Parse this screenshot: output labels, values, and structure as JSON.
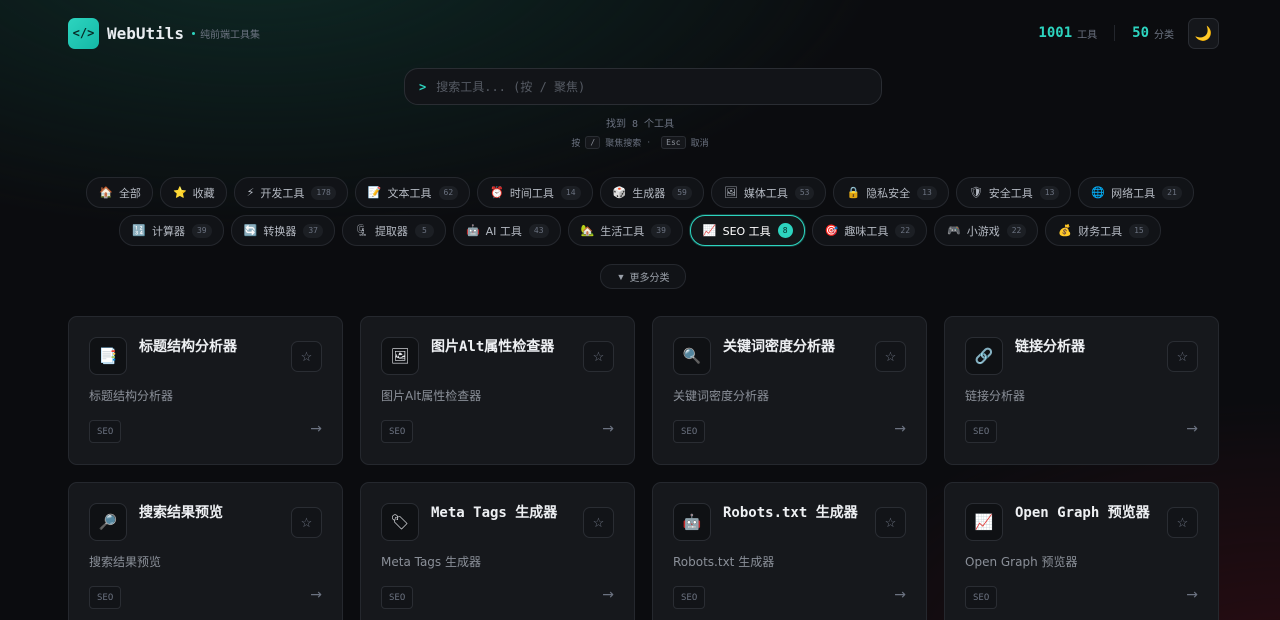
{
  "header": {
    "logo_glyph": "</>",
    "brand": "WebUtils",
    "subtitle": "纯前端工具集",
    "tools_count": "1001",
    "tools_label": "工具",
    "categories_count": "50",
    "categories_label": "分类",
    "theme_icon": "🌙"
  },
  "search": {
    "prompt": ">",
    "placeholder": "搜索工具... (按 / 聚焦)",
    "value": ""
  },
  "results": {
    "found_text": "找到 8 个工具",
    "hint_press": "按",
    "hint_slash_key": "/",
    "hint_focus": "聚焦搜索",
    "hint_dot": "·",
    "hint_esc_key": "Esc",
    "hint_cancel": "取消"
  },
  "categories_row1": [
    {
      "icon": "🏠",
      "label": "全部",
      "count": ""
    },
    {
      "icon": "⭐",
      "label": "收藏",
      "count": ""
    },
    {
      "icon": "⚡",
      "label": "开发工具",
      "count": "178"
    },
    {
      "icon": "📝",
      "label": "文本工具",
      "count": "62"
    },
    {
      "icon": "⏰",
      "label": "时间工具",
      "count": "14"
    },
    {
      "icon": "🎲",
      "label": "生成器",
      "count": "59"
    },
    {
      "icon": "🖼",
      "label": "媒体工具",
      "count": "53"
    },
    {
      "icon": "🔒",
      "label": "隐私安全",
      "count": "13"
    },
    {
      "icon": "🛡",
      "label": "安全工具",
      "count": "13"
    },
    {
      "icon": "🌐",
      "label": "网络工具",
      "count": "21"
    }
  ],
  "categories_row2": [
    {
      "icon": "🔢",
      "label": "计算器",
      "count": "39"
    },
    {
      "icon": "🔄",
      "label": "转换器",
      "count": "37"
    },
    {
      "icon": "🗜",
      "label": "提取器",
      "count": "5"
    },
    {
      "icon": "🤖",
      "label": "AI 工具",
      "count": "43"
    },
    {
      "icon": "🏡",
      "label": "生活工具",
      "count": "39"
    },
    {
      "icon": "📈",
      "label": "SEO 工具",
      "count": "8"
    },
    {
      "icon": "🎯",
      "label": "趣味工具",
      "count": "22"
    },
    {
      "icon": "🎮",
      "label": "小游戏",
      "count": "22"
    },
    {
      "icon": "💰",
      "label": "财务工具",
      "count": "15"
    }
  ],
  "more_categories": {
    "arrow": "▼",
    "label": "更多分类"
  },
  "cards": [
    {
      "icon": "📑",
      "title": "标题结构分析器",
      "desc": "标题结构分析器",
      "tag": "SEO",
      "star": "☆",
      "arrow": "→"
    },
    {
      "icon": "🖼",
      "title": "图片Alt属性检查器",
      "desc": "图片Alt属性检查器",
      "tag": "SEO",
      "star": "☆",
      "arrow": "→"
    },
    {
      "icon": "🔍",
      "title": "关键词密度分析器",
      "desc": "关键词密度分析器",
      "tag": "SEO",
      "star": "☆",
      "arrow": "→"
    },
    {
      "icon": "🔗",
      "title": "链接分析器",
      "desc": "链接分析器",
      "tag": "SEO",
      "star": "☆",
      "arrow": "→"
    },
    {
      "icon": "🔎",
      "title": "搜索结果预览",
      "desc": "搜索结果预览",
      "tag": "SEO",
      "star": "☆",
      "arrow": "→"
    },
    {
      "icon": "🏷",
      "title": "Meta Tags 生成器",
      "desc": "Meta Tags 生成器",
      "tag": "SEO",
      "star": "☆",
      "arrow": "→"
    },
    {
      "icon": "🤖",
      "title": "Robots.txt 生成器",
      "desc": "Robots.txt 生成器",
      "tag": "SEO",
      "star": "☆",
      "arrow": "→"
    },
    {
      "icon": "📈",
      "title": "Open Graph 预览器",
      "desc": "Open Graph 预览器",
      "tag": "SEO",
      "star": "☆",
      "arrow": "→"
    }
  ]
}
